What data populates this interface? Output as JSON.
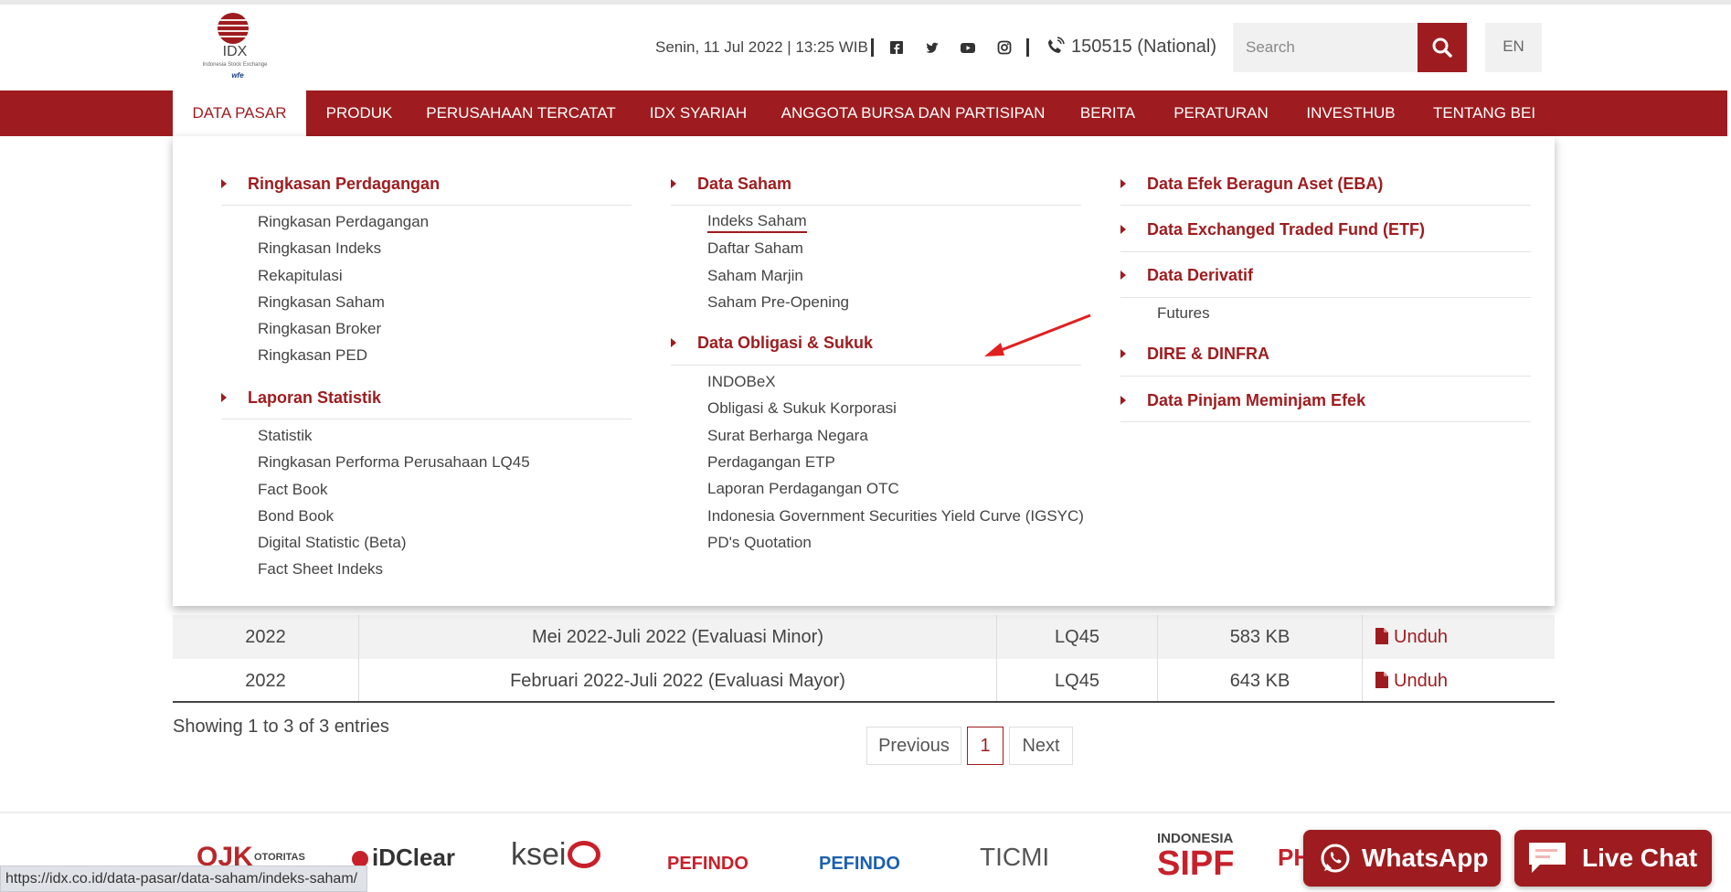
{
  "header": {
    "logo": {
      "name": "IDX",
      "sub": "Indonesia Stock Exchange",
      "wfe": "wfe"
    },
    "datetime": "Senin, 11 Jul 2022 | 13:25 WIB",
    "social_icons": [
      "facebook-icon",
      "twitter-icon",
      "youtube-icon",
      "instagram-icon"
    ],
    "phone": "150515 (National)",
    "search_placeholder": "Search",
    "lang": "EN"
  },
  "nav": {
    "items": [
      {
        "label": "DATA PASAR"
      },
      {
        "label": "PRODUK"
      },
      {
        "label": "PERUSAHAAN TERCATAT"
      },
      {
        "label": "IDX SYARIAH"
      },
      {
        "label": "ANGGOTA BURSA DAN PARTISIPAN"
      },
      {
        "label": "BERITA"
      },
      {
        "label": "PERATURAN"
      },
      {
        "label": "INVESTHUB"
      },
      {
        "label": "TENTANG BEI"
      }
    ]
  },
  "menu": {
    "col1": {
      "s1": {
        "title": "Ringkasan Perdagangan",
        "links": [
          "Ringkasan Perdagangan",
          "Ringkasan Indeks",
          "Rekapitulasi",
          "Ringkasan Saham",
          "Ringkasan Broker",
          "Ringkasan PED"
        ]
      },
      "s2": {
        "title": "Laporan Statistik",
        "links": [
          "Statistik",
          "Ringkasan Performa Perusahaan LQ45",
          "Fact Book",
          "Bond Book",
          "Digital Statistic (Beta)",
          "Fact Sheet Indeks"
        ]
      }
    },
    "col2": {
      "s1": {
        "title": "Data Saham",
        "links": [
          "Indeks Saham",
          "Daftar Saham",
          "Saham Marjin",
          "Saham Pre-Opening"
        ]
      },
      "s2": {
        "title": "Data Obligasi & Sukuk",
        "links": [
          "INDOBeX",
          "Obligasi & Sukuk Korporasi",
          "Surat Berharga Negara",
          "Perdagangan ETP",
          "Laporan Perdagangan OTC",
          "Indonesia Government Securities Yield Curve (IGSYC)",
          "PD's Quotation"
        ]
      }
    },
    "col3": {
      "s1": {
        "title": "Data Efek Beragun Aset (EBA)"
      },
      "s2": {
        "title": "Data Exchanged Traded Fund (ETF)"
      },
      "s3": {
        "title": "Data Derivatif",
        "links": [
          "Futures"
        ]
      },
      "s4": {
        "title": "DIRE & DINFRA"
      },
      "s5": {
        "title": "Data Pinjam Meminjam Efek"
      }
    }
  },
  "table": {
    "rows": [
      {
        "year": "2022",
        "period": "Mei 2022-Juli 2022 (Evaluasi Minor)",
        "index": "LQ45",
        "size": "583 KB",
        "action": "Unduh"
      },
      {
        "year": "2022",
        "period": "Februari 2022-Juli 2022 (Evaluasi Mayor)",
        "index": "LQ45",
        "size": "643 KB",
        "action": "Unduh"
      }
    ],
    "entries": "Showing 1 to 3 of 3 entries",
    "pagination": {
      "prev": "Previous",
      "page": "1",
      "next": "Next"
    }
  },
  "footer": {
    "logos": [
      "OJK",
      "OTORITAS",
      "iDClear",
      "ksei",
      "PEFINDO",
      "PEFINDO",
      "TICMI",
      "INDONESIA",
      "SIPF",
      "PH"
    ],
    "whatsapp": "WhatsApp",
    "livechat": "Live Chat"
  },
  "status_url": "https://idx.co.id/data-pasar/data-saham/indeks-saham/",
  "colors": {
    "brand": "#9e1c1f",
    "annotation": "#e02020"
  }
}
